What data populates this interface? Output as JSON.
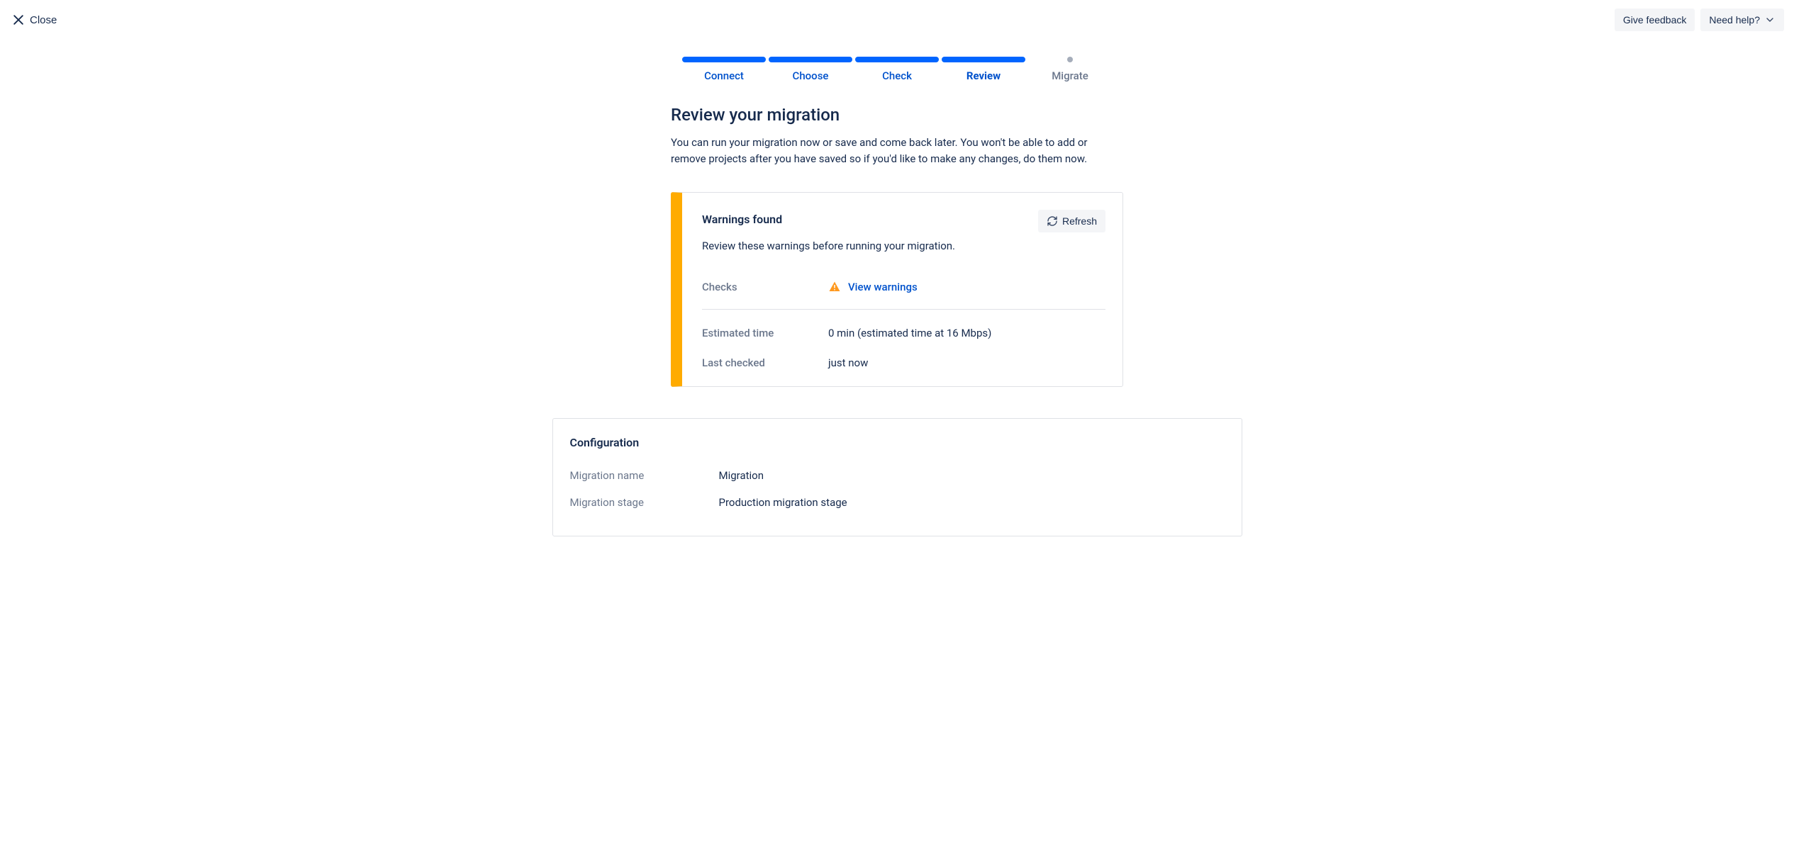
{
  "topbar": {
    "close_label": "Close",
    "give_feedback_label": "Give feedback",
    "need_help_label": "Need help?"
  },
  "stepper": {
    "steps": [
      "Connect",
      "Choose",
      "Check",
      "Review",
      "Migrate"
    ]
  },
  "page": {
    "title": "Review your migration",
    "description": "You can run your migration now or save and come back later. You won't be able to add or remove projects after you have saved so if you'd like to make any changes, do them now."
  },
  "warnings": {
    "title": "Warnings found",
    "description": "Review these warnings before running your migration.",
    "refresh_label": "Refresh",
    "checks_label": "Checks",
    "view_warnings_label": "View warnings",
    "est_time_label": "Estimated time",
    "est_time_value": "0 min (estimated time at 16 Mbps)",
    "last_checked_label": "Last checked",
    "last_checked_value": "just now"
  },
  "config": {
    "title": "Configuration",
    "rows": [
      {
        "label": "Migration name",
        "value": "Migration"
      },
      {
        "label": "Migration stage",
        "value": "Production migration stage"
      }
    ]
  }
}
